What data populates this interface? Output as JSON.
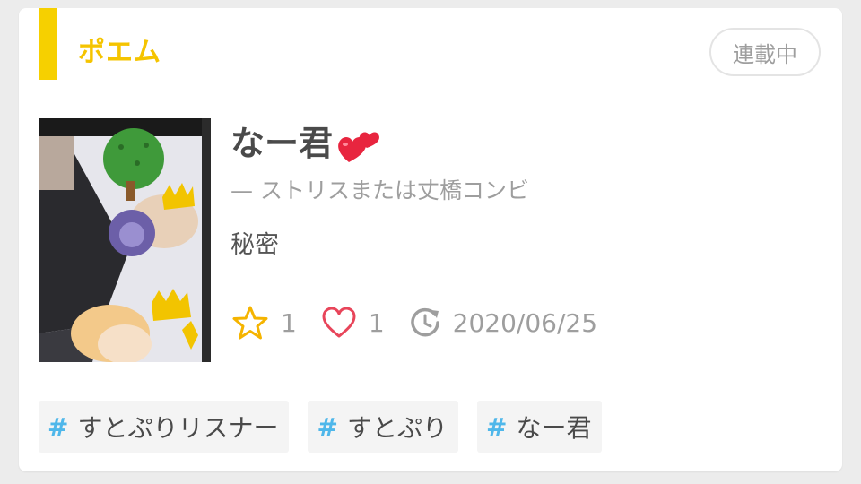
{
  "card": {
    "category": "ポエム",
    "status": "連載中",
    "title": "なー君",
    "author": "— ストリスまたは丈橋コンビ",
    "description": "秘密",
    "stats": {
      "stars": "1",
      "likes": "1",
      "updated": "2020/06/25"
    },
    "tags": [
      "すとぷりリスナー",
      "すとぷり",
      "なー君"
    ]
  },
  "colors": {
    "accent": "#f6d000",
    "category_text": "#f5c400",
    "star": "#f5b400",
    "heart": "#e8455a",
    "hash": "#4fb7ea"
  }
}
